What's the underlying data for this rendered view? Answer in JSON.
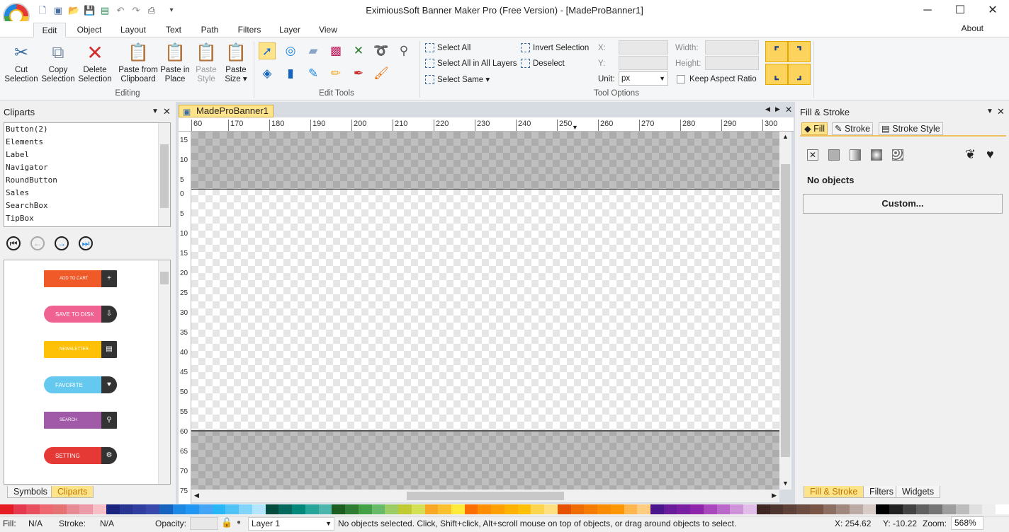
{
  "window": {
    "title": "EximiousSoft Banner Maker Pro (Free Version) - [MadeProBanner1]",
    "about": "About"
  },
  "tabs": [
    "Edit",
    "Object",
    "Layout",
    "Text",
    "Path",
    "Filters",
    "Layer",
    "View"
  ],
  "ribbon": {
    "editing": {
      "label": "Editing",
      "cut": [
        "Cut",
        "Selection"
      ],
      "copy": [
        "Copy",
        "Selection"
      ],
      "delete": [
        "Delete",
        "Selection"
      ],
      "paste_clipboard": [
        "Paste from",
        "Clipboard"
      ],
      "paste_place": [
        "Paste in",
        "Place"
      ],
      "paste_style": [
        "Paste",
        "Style"
      ],
      "paste_size": [
        "Paste",
        "Size ▾"
      ]
    },
    "edit_tools": {
      "label": "Edit Tools"
    },
    "selection": {
      "select_all": "Select All",
      "select_all_layers": "Select All in All Layers",
      "select_same": "Select Same ▾",
      "invert": "Invert Selection",
      "deselect": "Deselect"
    },
    "tool_options": {
      "label": "Tool Options",
      "x": "X:",
      "y": "Y:",
      "unit_label": "Unit:",
      "unit": "px",
      "width": "Width:",
      "height": "Height:",
      "keep_aspect": "Keep Aspect Ratio"
    }
  },
  "cliparts": {
    "title": "Cliparts",
    "items": [
      "Button(2)",
      "Elements",
      "Label",
      "Navigator",
      "RoundButton",
      "Sales",
      "SearchBox",
      "TipBox"
    ],
    "preview": [
      {
        "label": "ADD TO CART",
        "color": "#f05a28"
      },
      {
        "label": "SAVE TO DISK",
        "color": "#f06292"
      },
      {
        "label": "NEWSLETTER",
        "color": "#ffc107"
      },
      {
        "label": "FAVORITE",
        "color": "#64c8ef"
      },
      {
        "label": "SEARCH",
        "color": "#a05aa8"
      },
      {
        "label": "SETTING",
        "color": "#e53935"
      }
    ],
    "bottom_tabs": [
      "Symbols",
      "Cliparts"
    ]
  },
  "document": {
    "tab": "MadeProBanner1",
    "ruler_top": [
      "60",
      "170",
      "180",
      "190",
      "200",
      "210",
      "220",
      "230",
      "240",
      "250",
      "260",
      "270",
      "280",
      "290",
      "300"
    ],
    "ruler_left": [
      "15",
      "10",
      "5",
      "0",
      "5",
      "10",
      "15",
      "20",
      "25",
      "30",
      "35",
      "40",
      "45",
      "50",
      "55",
      "60",
      "65",
      "70",
      "75"
    ]
  },
  "fill_stroke": {
    "title": "Fill & Stroke",
    "tabs": [
      "Fill",
      "Stroke",
      "Stroke Style"
    ],
    "no_objects": "No objects",
    "custom": "Custom...",
    "bottom_tabs": [
      "Fill & Stroke",
      "Filters",
      "Widgets"
    ]
  },
  "palette": [
    "#e51c23",
    "#e53950",
    "#e8505d",
    "#ee6872",
    "#e57373",
    "#e88a95",
    "#ec9aa8",
    "#f7c0c8",
    "#1a237e",
    "#283593",
    "#303f9f",
    "#3949ab",
    "#1565c0",
    "#1e88e5",
    "#2196f3",
    "#42a5f5",
    "#29b6f6",
    "#4fc3f7",
    "#81d4fa",
    "#b3e5fc",
    "#004d40",
    "#00695c",
    "#00897b",
    "#26a69a",
    "#4db6ac",
    "#1b5e20",
    "#2e7d32",
    "#43a047",
    "#66bb6a",
    "#9ccc65",
    "#c0ca33",
    "#d4e157",
    "#f9a825",
    "#fbc02d",
    "#ffeb3b",
    "#ff6f00",
    "#ff8f00",
    "#ffa000",
    "#ffb300",
    "#ffc107",
    "#ffd54f",
    "#ffe082",
    "#e65100",
    "#ef6c00",
    "#f57c00",
    "#fb8c00",
    "#ff9800",
    "#ffb74d",
    "#ffcc80",
    "#4a148c",
    "#6a1b9a",
    "#7b1fa2",
    "#8e24aa",
    "#ab47bc",
    "#ba68c8",
    "#ce93d8",
    "#e1bee7",
    "#3e2723",
    "#4e342e",
    "#5d4037",
    "#6d4c41",
    "#795548",
    "#8d6e63",
    "#a1887f",
    "#bcaaa4",
    "#d7ccc8",
    "#000000",
    "#212121",
    "#424242",
    "#616161",
    "#757575",
    "#9e9e9e",
    "#bdbdbd",
    "#e0e0e0",
    "#eeeeee",
    "#ffffff"
  ],
  "status": {
    "fill_label": "Fill:",
    "fill_value": "N/A",
    "stroke_label": "Stroke:",
    "stroke_value": "N/A",
    "opacity_label": "Opacity:",
    "layer": "Layer 1",
    "message": "No objects selected. Click, Shift+click, Alt+scroll mouse on top of objects, or drag around objects to select.",
    "x": "X:  254.62",
    "y": "Y:  -10.22",
    "zoom_label": "Zoom:",
    "zoom": "568%"
  }
}
